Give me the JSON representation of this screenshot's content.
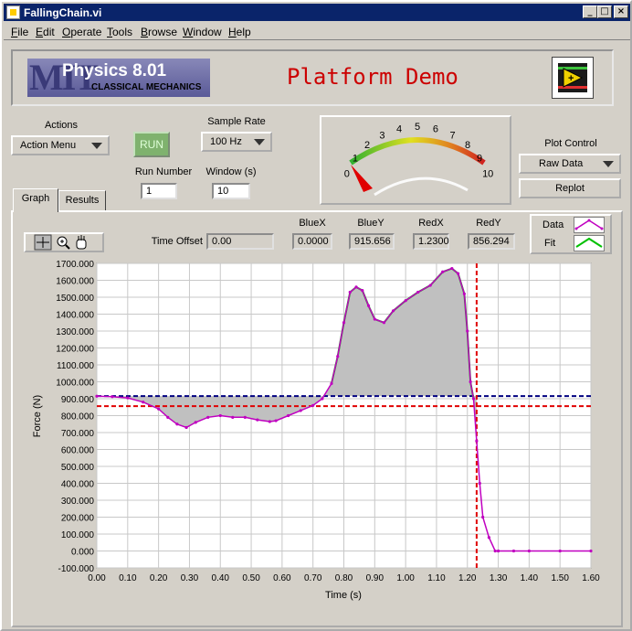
{
  "window": {
    "title": "FallingChain.vi"
  },
  "title_buttons": {
    "minimize": "_",
    "maximize": "□",
    "close": "×"
  },
  "menu": [
    {
      "u": "F",
      "rest": "ile"
    },
    {
      "u": "E",
      "rest": "dit"
    },
    {
      "u": "O",
      "rest": "perate"
    },
    {
      "u": "T",
      "rest": "ools"
    },
    {
      "u": "B",
      "rest": "rowse"
    },
    {
      "u": "W",
      "rest": "indow"
    },
    {
      "u": "H",
      "rest": "elp"
    }
  ],
  "banner": {
    "logo_letters": "MIT",
    "logo_title": "Physics 8.01",
    "logo_subtitle": "CLASSICAL MECHANICS",
    "title": "Platform Demo"
  },
  "controls": {
    "actions_label": "Actions",
    "actions_value": "Action Menu",
    "run_label": "RUN",
    "sample_rate_label": "Sample Rate",
    "sample_rate_value": "100 Hz",
    "run_number_label": "Run Number",
    "run_number_value": "1",
    "window_label": "Window (s)",
    "window_value": "10",
    "plot_control_label": "Plot Control",
    "plot_control_value": "Raw Data",
    "replot_label": "Replot"
  },
  "meter": {
    "ticks": [
      "0",
      "1",
      "2",
      "3",
      "4",
      "5",
      "6",
      "7",
      "8",
      "9",
      "10"
    ],
    "value": 0
  },
  "tabs": {
    "graph": "Graph",
    "results": "Results"
  },
  "readouts": {
    "time_offset_label": "Time Offset",
    "time_offset_value": "0.00",
    "bluex_label": "BlueX",
    "bluex_value": "0.0000",
    "bluey_label": "BlueY",
    "bluey_value": "915.656",
    "redx_label": "RedX",
    "redx_value": "1.2300",
    "redy_label": "RedY",
    "redy_value": "856.294"
  },
  "legend": {
    "data_label": "Data",
    "fit_label": "Fit"
  },
  "colors": {
    "data": "#c000c0",
    "fit": "#00c000",
    "blue_cursor": "#000080",
    "red_cursor": "#e00000",
    "fill": "#c0c0c0"
  },
  "chart_data": {
    "type": "line",
    "xlabel": "Time (s)",
    "ylabel": "Force (N)",
    "xlim": [
      0.0,
      1.6
    ],
    "ylim": [
      -100,
      1700
    ],
    "x_ticks": [
      "0.00",
      "0.10",
      "0.20",
      "0.30",
      "0.40",
      "0.50",
      "0.60",
      "0.70",
      "0.80",
      "0.90",
      "1.00",
      "1.10",
      "1.20",
      "1.30",
      "1.40",
      "1.50",
      "1.60"
    ],
    "y_ticks": [
      "1700.000",
      "1600.000",
      "1500.000",
      "1400.000",
      "1300.000",
      "1200.000",
      "1100.000",
      "1000.000",
      "900.000",
      "800.000",
      "700.000",
      "600.000",
      "500.000",
      "400.000",
      "300.000",
      "200.000",
      "100.000",
      "0.000",
      "-100.000"
    ],
    "cursors": {
      "blue_y": 915.656,
      "red_x": 1.23,
      "red_y": 856.294
    },
    "series": [
      {
        "name": "Data",
        "x": [
          0.0,
          0.05,
          0.1,
          0.15,
          0.2,
          0.23,
          0.26,
          0.29,
          0.32,
          0.36,
          0.4,
          0.44,
          0.48,
          0.52,
          0.56,
          0.58,
          0.62,
          0.66,
          0.7,
          0.73,
          0.76,
          0.78,
          0.8,
          0.82,
          0.84,
          0.86,
          0.88,
          0.9,
          0.93,
          0.96,
          1.0,
          1.04,
          1.08,
          1.12,
          1.15,
          1.17,
          1.19,
          1.2,
          1.21,
          1.22,
          1.23,
          1.24,
          1.25,
          1.27,
          1.29,
          1.3,
          1.35,
          1.4,
          1.5,
          1.6
        ],
        "y": [
          915,
          912,
          905,
          880,
          840,
          790,
          750,
          730,
          760,
          790,
          800,
          790,
          790,
          775,
          765,
          770,
          800,
          830,
          860,
          900,
          990,
          1150,
          1350,
          1530,
          1560,
          1540,
          1450,
          1370,
          1350,
          1420,
          1480,
          1530,
          1570,
          1650,
          1670,
          1640,
          1520,
          1300,
          1000,
          900,
          650,
          400,
          200,
          80,
          0,
          0,
          0,
          0,
          0,
          0
        ]
      },
      {
        "name": "Fit",
        "x": [
          0.76,
          0.78,
          0.8,
          0.82,
          0.84,
          0.86,
          0.88,
          0.9,
          0.93,
          0.96,
          1.0,
          1.04,
          1.08,
          1.12,
          1.15,
          1.17,
          1.19,
          1.2,
          1.21,
          1.22
        ],
        "y": [
          990,
          1150,
          1350,
          1530,
          1560,
          1540,
          1450,
          1370,
          1350,
          1420,
          1480,
          1530,
          1570,
          1650,
          1670,
          1640,
          1520,
          1300,
          1000,
          900
        ]
      }
    ]
  }
}
